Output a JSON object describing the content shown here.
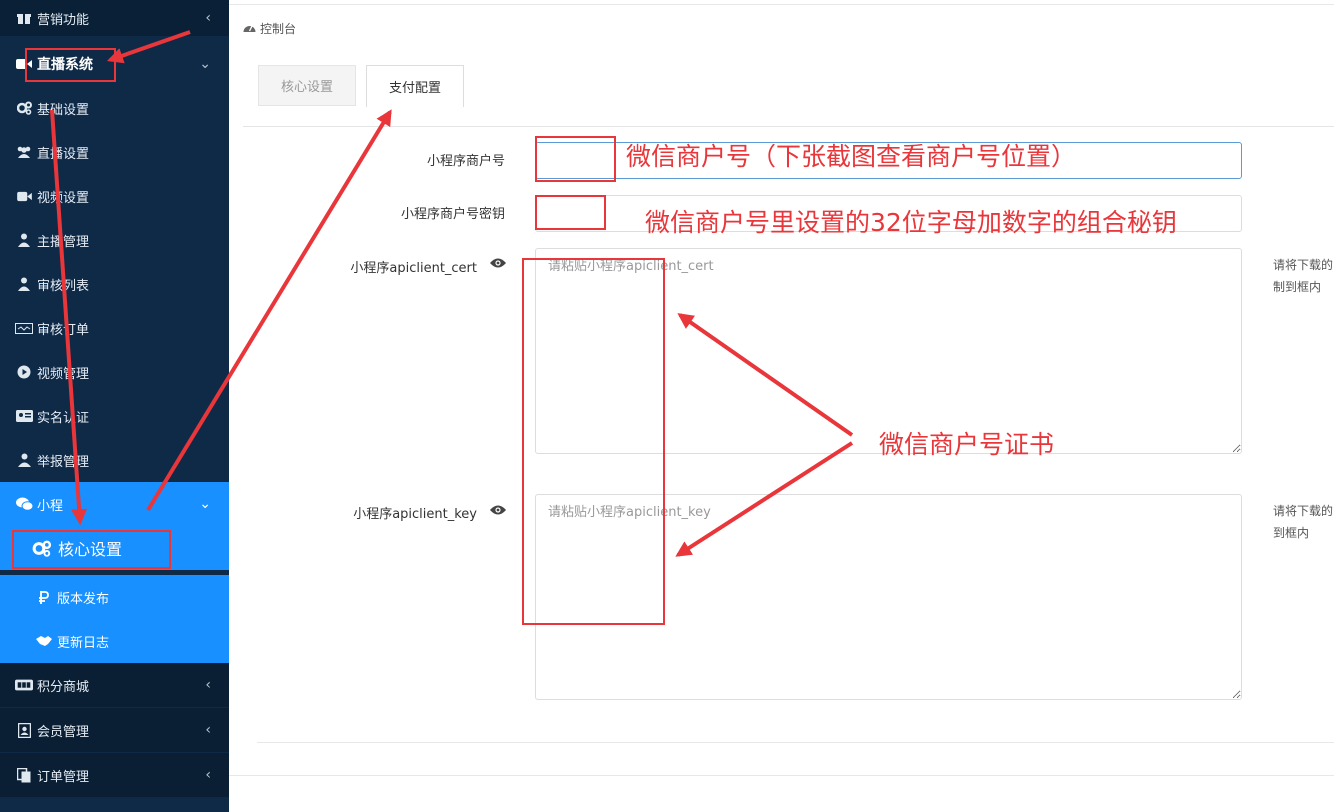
{
  "sidebar": {
    "marketing": "营销功能",
    "live_system": "直播系统",
    "items": [
      {
        "label": "基础设置",
        "icon": "gears-icon"
      },
      {
        "label": "直播设置",
        "icon": "users-icon"
      },
      {
        "label": "视频设置",
        "icon": "video-camera-icon"
      },
      {
        "label": "主播管理",
        "icon": "user-icon"
      },
      {
        "label": "审核列表",
        "icon": "user-icon"
      },
      {
        "label": "审核订单",
        "icon": "card-icon"
      },
      {
        "label": "视频管理",
        "icon": "play-circle-icon"
      },
      {
        "label": "实名认证",
        "icon": "id-card-icon"
      },
      {
        "label": "举报管理",
        "icon": "user-shield-icon"
      }
    ],
    "mini_program": "小程序",
    "mini_program_shown": "小程",
    "sub_items": [
      {
        "label": "核心设置",
        "icon": "gears-icon"
      },
      {
        "label": "版本发布",
        "icon": "rouble-icon"
      },
      {
        "label": "更新日志",
        "icon": "handshake-icon"
      }
    ],
    "bottom_items": [
      {
        "label": "积分商城",
        "icon": "jcb-card-icon"
      },
      {
        "label": "会员管理",
        "icon": "contact-book-icon"
      },
      {
        "label": "订单管理",
        "icon": "copy-icon"
      }
    ]
  },
  "breadcrumb": "控制台",
  "tabs": [
    {
      "label": "核心设置"
    },
    {
      "label": "支付配置"
    }
  ],
  "form": {
    "merchant_id_label": "小程序商户号",
    "merchant_id_value": "",
    "merchant_key_label": "小程序商户号密钥",
    "merchant_key_value": "",
    "cert_label": "小程序apiclient_cert",
    "cert_placeholder": "请粘贴小程序apiclient_cert",
    "cert_hint_1": "请将下载的",
    "cert_hint_2": "制到框内",
    "key_label": "小程序apiclient_key",
    "key_placeholder": "请粘贴小程序apiclient_key",
    "key_hint_1": "请将下载的",
    "key_hint_2": "到框内"
  },
  "annotations": {
    "merchant_id": "微信商户号（下张截图查看商户号位置）",
    "merchant_key": "微信商户号里设置的32位字母加数字的组合秘钥",
    "cert": "微信商户号证书"
  },
  "colors": {
    "sidebar_bg": "#0f2a47",
    "active_bg": "#1890ff",
    "annotation": "#e8363a"
  }
}
